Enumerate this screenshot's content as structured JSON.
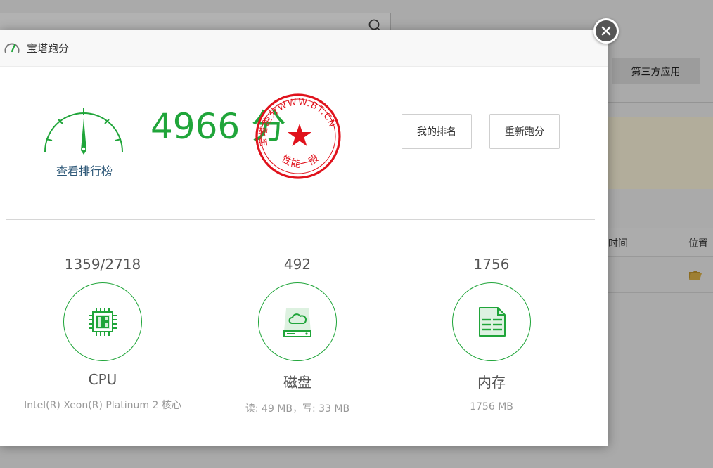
{
  "background": {
    "third_party_apps_label": "第三方应用",
    "table_col_time": "时间",
    "table_col_location": "位置"
  },
  "modal": {
    "title": "宝塔跑分",
    "score_text": "4966 分",
    "rank_link": "查看排行榜",
    "stamp": {
      "top_text": "宝塔跑分WWW.BT.CN",
      "bottom_text": "性能一般"
    },
    "buttons": {
      "my_rank": "我的排名",
      "rerun": "重新跑分"
    },
    "stats": {
      "cpu": {
        "value": "1359/2718",
        "name": "CPU",
        "desc": "Intel(R) Xeon(R) Platinum 2 核心"
      },
      "disk": {
        "value": "492",
        "name": "磁盘",
        "desc": "读: 49 MB，写: 33 MB"
      },
      "memory": {
        "value": "1756",
        "name": "内存",
        "desc": "1756 MB"
      }
    }
  },
  "colors": {
    "accent_green": "#20a53a",
    "stamp_red": "#e0121c",
    "link_blue": "#2c5777"
  }
}
